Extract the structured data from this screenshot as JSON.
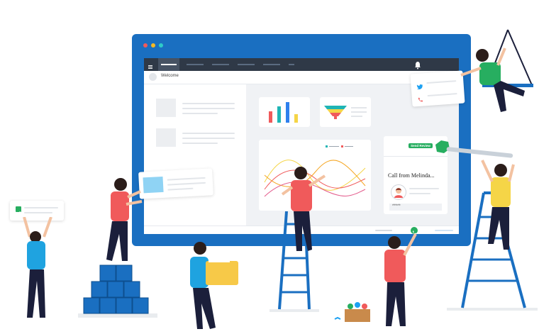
{
  "dashboard": {
    "welcome_text": "Welcome",
    "send_review_label": "Send Review",
    "call_title": "Call from Melinda...",
    "call_masked_number": "*****"
  },
  "colors": {
    "monitor_frame": "#1a6fc1",
    "topbar": "#2f3947",
    "accent_red": "#f05a5b",
    "accent_teal": "#1fb5b5",
    "accent_blue": "#2f80ed",
    "accent_yellow": "#f5d547",
    "call_green": "#27ae60",
    "window_dot_red": "#f05a5b",
    "window_dot_yellow": "#f7b924",
    "window_dot_green": "#2ecbc8"
  },
  "icons": {
    "menu": "hamburger-menu-icon",
    "bell": "bell-icon",
    "phone": "phone-icon",
    "twitter": "twitter-icon",
    "checkbox": "checkbox-icon"
  }
}
